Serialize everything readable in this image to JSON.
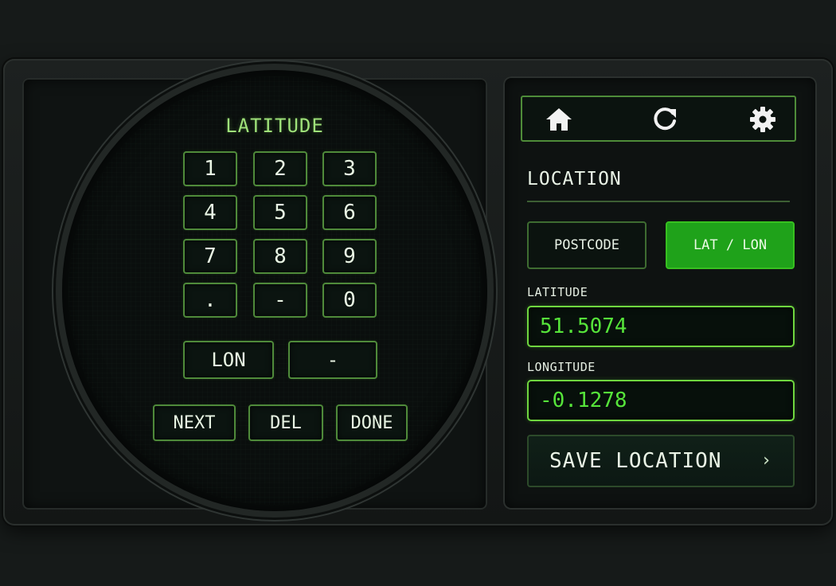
{
  "keypad": {
    "title": "LATITUDE",
    "keys": [
      "1",
      "2",
      "3",
      "4",
      "5",
      "6",
      "7",
      "8",
      "9",
      ".",
      "-",
      "0"
    ],
    "switch_label": "LON",
    "sign_label": "-",
    "next_label": "NEXT",
    "del_label": "DEL",
    "done_label": "DONE"
  },
  "toolbar": {
    "home_icon": "home-icon",
    "refresh_icon": "refresh-icon",
    "settings_icon": "gear-icon"
  },
  "location": {
    "title": "LOCATION",
    "mode_postcode": "POSTCODE",
    "mode_latlon": "LAT / LON",
    "active_mode": "LAT / LON",
    "latitude_label": "LATITUDE",
    "latitude_value": "51.5074",
    "longitude_label": "LONGITUDE",
    "longitude_value": "-0.1278",
    "save_label": "SAVE LOCATION",
    "save_chevron": "›"
  },
  "colors": {
    "accent_green": "#1fa21a",
    "value_green": "#56e43a",
    "label_green": "#9fe27a",
    "border_green": "#4f8a3a",
    "background": "#161a19"
  }
}
